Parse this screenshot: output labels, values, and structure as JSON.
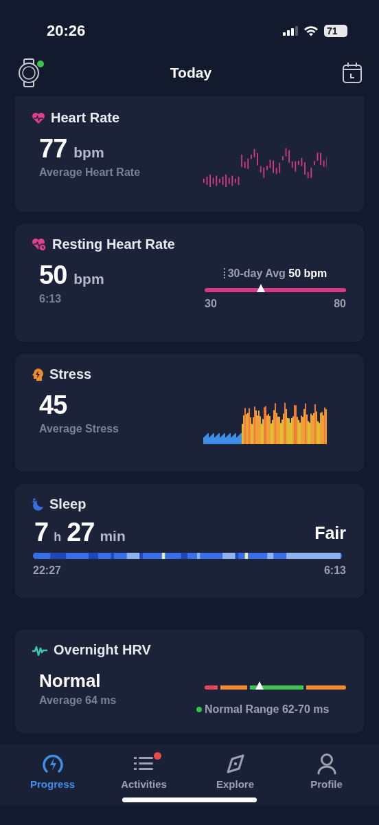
{
  "status_bar": {
    "time": "20:26",
    "battery": "71"
  },
  "header": {
    "title": "Today",
    "device_connected": true
  },
  "cards": [
    {
      "kind": "heart_rate",
      "title": "Heart Rate",
      "value": "77",
      "unit": "bpm",
      "caption": "Average Heart Rate"
    },
    {
      "kind": "resting",
      "title": "Resting Heart Rate",
      "value": "50",
      "unit": "bpm",
      "time": "6:13",
      "avg_label": "30-day Avg",
      "avg_value": "50 bpm",
      "range_min": "30",
      "range_max": "80",
      "level": 0.4
    },
    {
      "kind": "stress",
      "title": "Stress",
      "value": "45",
      "caption": "Average Stress"
    },
    {
      "kind": "sleep",
      "title": "Sleep",
      "hours": "7",
      "hours_unit": "h",
      "minutes": "27",
      "minutes_unit": "min",
      "rating": "Fair",
      "start": "22:27",
      "end": "6:13"
    },
    {
      "kind": "hrv",
      "title": "Overnight HRV",
      "status": "Normal",
      "caption": "Average 64 ms",
      "range_text": "Normal Range 62-70 ms",
      "level": 0.39
    }
  ],
  "tabs": [
    {
      "label": "Progress",
      "selected": true,
      "badge": false
    },
    {
      "label": "Activities",
      "selected": false,
      "badge": true
    },
    {
      "label": "Explore",
      "selected": false,
      "badge": false
    },
    {
      "label": "Profile",
      "selected": false,
      "badge": false
    }
  ]
}
